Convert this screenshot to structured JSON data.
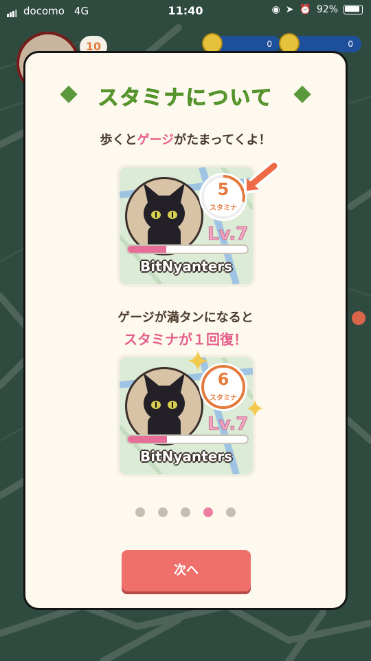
{
  "status_bar": {
    "carrier": "docomo",
    "network": "4G",
    "time": "11:40",
    "battery": "92%"
  },
  "hud": {
    "level_badge": "10",
    "counter_1": "0",
    "counter_2": "0"
  },
  "modal": {
    "title": "スタミナについて",
    "line1_pre": "歩くと",
    "line1_emph": "ゲージ",
    "line1_post": "がたまってくよ！",
    "line2": "ゲージが満タンになると",
    "line3": "スタミナが１回復！",
    "next_button": "次へ"
  },
  "cards": [
    {
      "stamina": "5",
      "stamina_label": "スタミナ",
      "level": "Lv.7",
      "name": "BitNyanters",
      "gauge_fraction": 0.32
    },
    {
      "stamina": "6",
      "stamina_label": "スタミナ",
      "level": "Lv.7",
      "name": "BitNyanters",
      "gauge_fraction": 0.33
    }
  ],
  "pagination": {
    "total": 5,
    "active_index": 3
  },
  "colors": {
    "accent_pink": "#e55d8a",
    "title_green": "#7bbf3f",
    "button_red": "#ef6f6b",
    "stamina_orange": "#e47a3c"
  },
  "icons": [
    "signal-icon",
    "alarm-icon",
    "location-arrow-icon",
    "lock-rotation-icon",
    "battery-icon",
    "coin-icon",
    "pointer-arrow-icon",
    "sparkle-icon"
  ]
}
